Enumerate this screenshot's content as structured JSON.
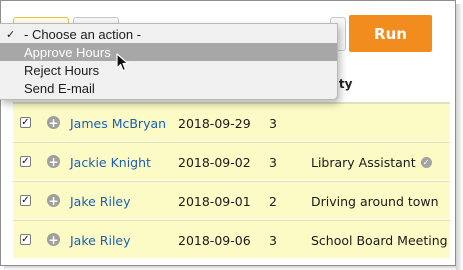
{
  "toolbar": {
    "run_label": "Run",
    "run_color": "#f28c1e"
  },
  "action_menu": {
    "items": [
      {
        "label": "- Choose an action -",
        "checked": true,
        "highlighted": false
      },
      {
        "label": "Approve Hours",
        "checked": false,
        "highlighted": true
      },
      {
        "label": "Reject Hours",
        "checked": false,
        "highlighted": false
      },
      {
        "label": "Send E-mail",
        "checked": false,
        "highlighted": false
      }
    ],
    "check_mark": "✓"
  },
  "table": {
    "headers": {
      "activity_partial": "vity"
    },
    "rows": [
      {
        "checked": true,
        "name": "James McBryan",
        "date": "2018-09-29",
        "hours": "3",
        "activity": "",
        "verified": false
      },
      {
        "checked": true,
        "name": "Jackie Knight",
        "date": "2018-09-02",
        "hours": "3",
        "activity": "Library Assistant",
        "verified": true
      },
      {
        "checked": true,
        "name": "Jake Riley",
        "date": "2018-09-01",
        "hours": "2",
        "activity": "Driving around town",
        "verified": false
      },
      {
        "checked": true,
        "name": "Jake Riley",
        "date": "2018-09-06",
        "hours": "3",
        "activity": "School Board Meeting",
        "verified": false
      }
    ],
    "row_color": "#fdfbc5",
    "name_link_color": "#1a5fb4",
    "checkbox_glyph": "✓",
    "expand_glyph": "+",
    "verified_glyph": "✓"
  },
  "icons": {
    "cursor": "mouse-pointer-icon",
    "expand": "plus-circle-icon",
    "verified": "check-circle-icon"
  }
}
